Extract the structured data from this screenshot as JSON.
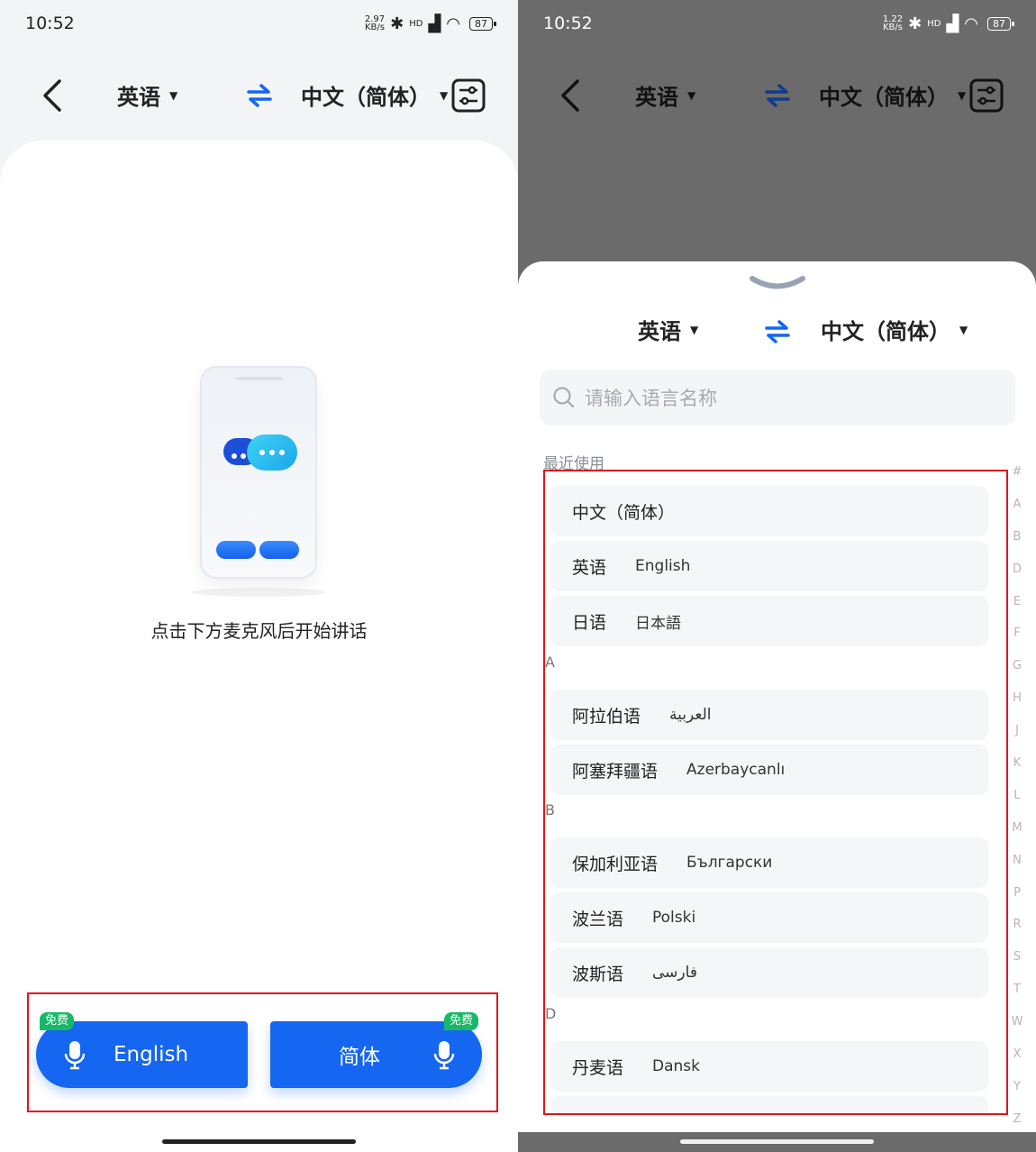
{
  "left": {
    "status": {
      "time": "10:52",
      "speed_value": "2.97",
      "speed_unit": "KB/s",
      "network": "HD",
      "battery": "87"
    },
    "header": {
      "source_lang": "英语",
      "target_lang": "中文（简体）"
    },
    "hint": "点击下方麦克风后开始讲话",
    "mic_buttons": [
      {
        "label": "English",
        "badge": "免费"
      },
      {
        "label": "简体",
        "badge": "免费"
      }
    ]
  },
  "right": {
    "status": {
      "time": "10:52",
      "speed_value": "1.22",
      "speed_unit": "KB/s",
      "network": "HD",
      "battery": "87"
    },
    "header": {
      "source_lang": "英语",
      "target_lang": "中文（简体）"
    },
    "sheet": {
      "source_lang": "英语",
      "target_lang": "中文（简体）",
      "search_placeholder": "请输入语言名称",
      "recent_label": "最近使用",
      "recent": [
        {
          "name": "中文（简体）",
          "native": ""
        },
        {
          "name": "英语",
          "native": "English"
        },
        {
          "name": "日语",
          "native": "日本語"
        }
      ],
      "sections": [
        {
          "letter": "A",
          "items": [
            {
              "name": "阿拉伯语",
              "native": "العربية"
            },
            {
              "name": "阿塞拜疆语",
              "native": "Azerbaycanlı"
            }
          ]
        },
        {
          "letter": "B",
          "items": [
            {
              "name": "保加利亚语",
              "native": "Български"
            },
            {
              "name": "波兰语",
              "native": "Polski"
            },
            {
              "name": "波斯语",
              "native": "فارسی"
            }
          ]
        },
        {
          "letter": "D",
          "items": [
            {
              "name": "丹麦语",
              "native": "Dansk"
            }
          ]
        }
      ],
      "index_letters": [
        "#",
        "A",
        "B",
        "D",
        "E",
        "F",
        "G",
        "H",
        "J",
        "K",
        "L",
        "M",
        "N",
        "P",
        "R",
        "S",
        "T",
        "W",
        "X",
        "Y",
        "Z"
      ]
    }
  },
  "colors": {
    "accent": "#1566f0",
    "badge": "#19b868",
    "highlight_frame": "#e1141c"
  }
}
